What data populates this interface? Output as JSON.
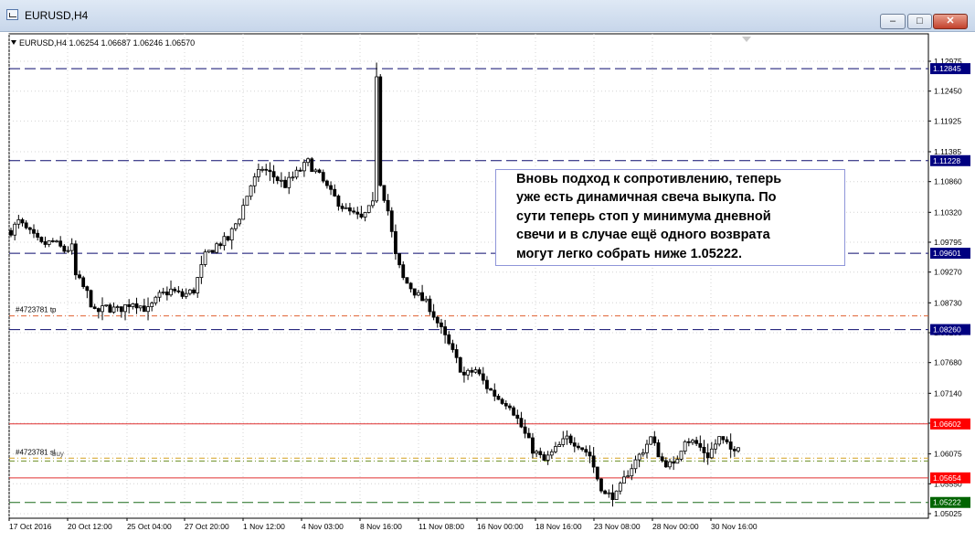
{
  "window": {
    "title": "EURUSD,H4",
    "app_icon": "chart-window-icon",
    "buttons": {
      "minimize": "–",
      "maximize": "□",
      "close": "✕"
    }
  },
  "header": {
    "text": "EURUSD,H4  1.06254 1.06687 1.06246 1.06570"
  },
  "axis": {
    "y_labels": [
      "1.12975",
      "1.12450",
      "1.11925",
      "1.11385",
      "1.10860",
      "1.10320",
      "1.09795",
      "1.09270",
      "1.08730",
      "1.08205",
      "1.07680",
      "1.07140",
      "1.06615",
      "1.06075",
      "1.05550",
      "1.05025"
    ],
    "x_labels": [
      "17 Oct 2016",
      "20 Oct 12:00",
      "25 Oct 04:00",
      "27 Oct 20:00",
      "1 Nov 12:00",
      "4 Nov 03:00",
      "8 Nov 16:00",
      "11 Nov 08:00",
      "16 Nov 00:00",
      "18 Nov 16:00",
      "23 Nov 08:00",
      "28 Nov 00:00",
      "30 Nov 16:00"
    ]
  },
  "levels": [
    {
      "price": 1.12845,
      "label": "1.12845",
      "style": "dash",
      "color": "#0b0b6e",
      "badge": "#000080"
    },
    {
      "price": 1.11228,
      "label": "1.11228",
      "style": "dash",
      "color": "#0b0b6e",
      "badge": "#000080"
    },
    {
      "price": 1.09601,
      "label": "1.09601",
      "style": "dash",
      "color": "#0b0b6e",
      "badge": "#000080"
    },
    {
      "price": 1.0826,
      "label": "1.08260",
      "style": "dash",
      "color": "#0b0b6e",
      "badge": "#000080"
    },
    {
      "price": 1.06602,
      "label": "1.06602",
      "style": "solid",
      "color": "#e03030",
      "badge": "#ff0000"
    },
    {
      "price": 1.05654,
      "label": "1.05654",
      "style": "solid",
      "color": "#e03030",
      "badge": "#ff0000"
    },
    {
      "price": 1.05222,
      "label": "1.05222",
      "style": "dash",
      "color": "#1a6b1a",
      "badge": "#006400"
    }
  ],
  "orders": [
    {
      "price": 1.085,
      "label": "#4723781 tp",
      "color": "#e06030"
    },
    {
      "price": 1.06,
      "label": "#4723781 sl",
      "color": "#d4a020"
    },
    {
      "price": 1.0595,
      "label": "buy",
      "color": "#6b8e23"
    }
  ],
  "note": {
    "lines": [
      "Вновь подход к сопротивлению, теперь",
      "уже есть динамичная свеча выкупа. По",
      "сути теперь стоп у минимума дневной",
      "свечи и в случае ещё одного возврата",
      "могут легко собрать ниже 1.05222."
    ]
  },
  "chart_data": {
    "type": "candlestick",
    "symbol": "EURUSD",
    "timeframe": "H4",
    "ylim": [
      1.05025,
      1.12975
    ],
    "path": [
      [
        0,
        1.1
      ],
      [
        2,
        1.1015
      ],
      [
        5,
        1.0995
      ],
      [
        8,
        1.0975
      ],
      [
        11,
        1.098
      ],
      [
        14,
        1.0965
      ],
      [
        16,
        1.097
      ],
      [
        17,
        1.092
      ],
      [
        20,
        1.089
      ],
      [
        22,
        1.0855
      ],
      [
        25,
        1.0865
      ],
      [
        28,
        1.086
      ],
      [
        32,
        1.0875
      ],
      [
        36,
        1.086
      ],
      [
        39,
        1.0885
      ],
      [
        42,
        1.0895
      ],
      [
        45,
        1.0885
      ],
      [
        48,
        1.0895
      ],
      [
        51,
        1.0955
      ],
      [
        54,
        1.0975
      ],
      [
        57,
        1.0985
      ],
      [
        60,
        1.1025
      ],
      [
        63,
        1.108
      ],
      [
        66,
        1.111
      ],
      [
        69,
        1.1095
      ],
      [
        72,
        1.108
      ],
      [
        75,
        1.11
      ],
      [
        78,
        1.112
      ],
      [
        81,
        1.1095
      ],
      [
        84,
        1.1065
      ],
      [
        88,
        1.1035
      ],
      [
        92,
        1.102
      ],
      [
        95,
        1.1045
      ],
      [
        96,
        1.1275
      ],
      [
        97,
        1.1085
      ],
      [
        99,
        1.1035
      ],
      [
        101,
        1.0955
      ],
      [
        103,
        1.0915
      ],
      [
        107,
        1.0885
      ],
      [
        110,
        1.0865
      ],
      [
        113,
        1.0825
      ],
      [
        116,
        1.0785
      ],
      [
        119,
        1.0745
      ],
      [
        122,
        1.0755
      ],
      [
        125,
        1.0725
      ],
      [
        128,
        1.0705
      ],
      [
        131,
        1.0695
      ],
      [
        134,
        1.0655
      ],
      [
        137,
        1.0615
      ],
      [
        140,
        1.0595
      ],
      [
        143,
        1.0615
      ],
      [
        146,
        1.0635
      ],
      [
        149,
        1.0625
      ],
      [
        152,
        1.0605
      ],
      [
        154,
        1.0565
      ],
      [
        156,
        1.0535
      ],
      [
        159,
        1.0535
      ],
      [
        162,
        1.0575
      ],
      [
        165,
        1.0605
      ],
      [
        168,
        1.0635
      ],
      [
        171,
        1.0595
      ],
      [
        174,
        1.0585
      ],
      [
        177,
        1.0635
      ],
      [
        180,
        1.0625
      ],
      [
        183,
        1.0605
      ],
      [
        186,
        1.0635
      ],
      [
        189,
        1.0615
      ],
      [
        191,
        1.0625
      ]
    ]
  }
}
